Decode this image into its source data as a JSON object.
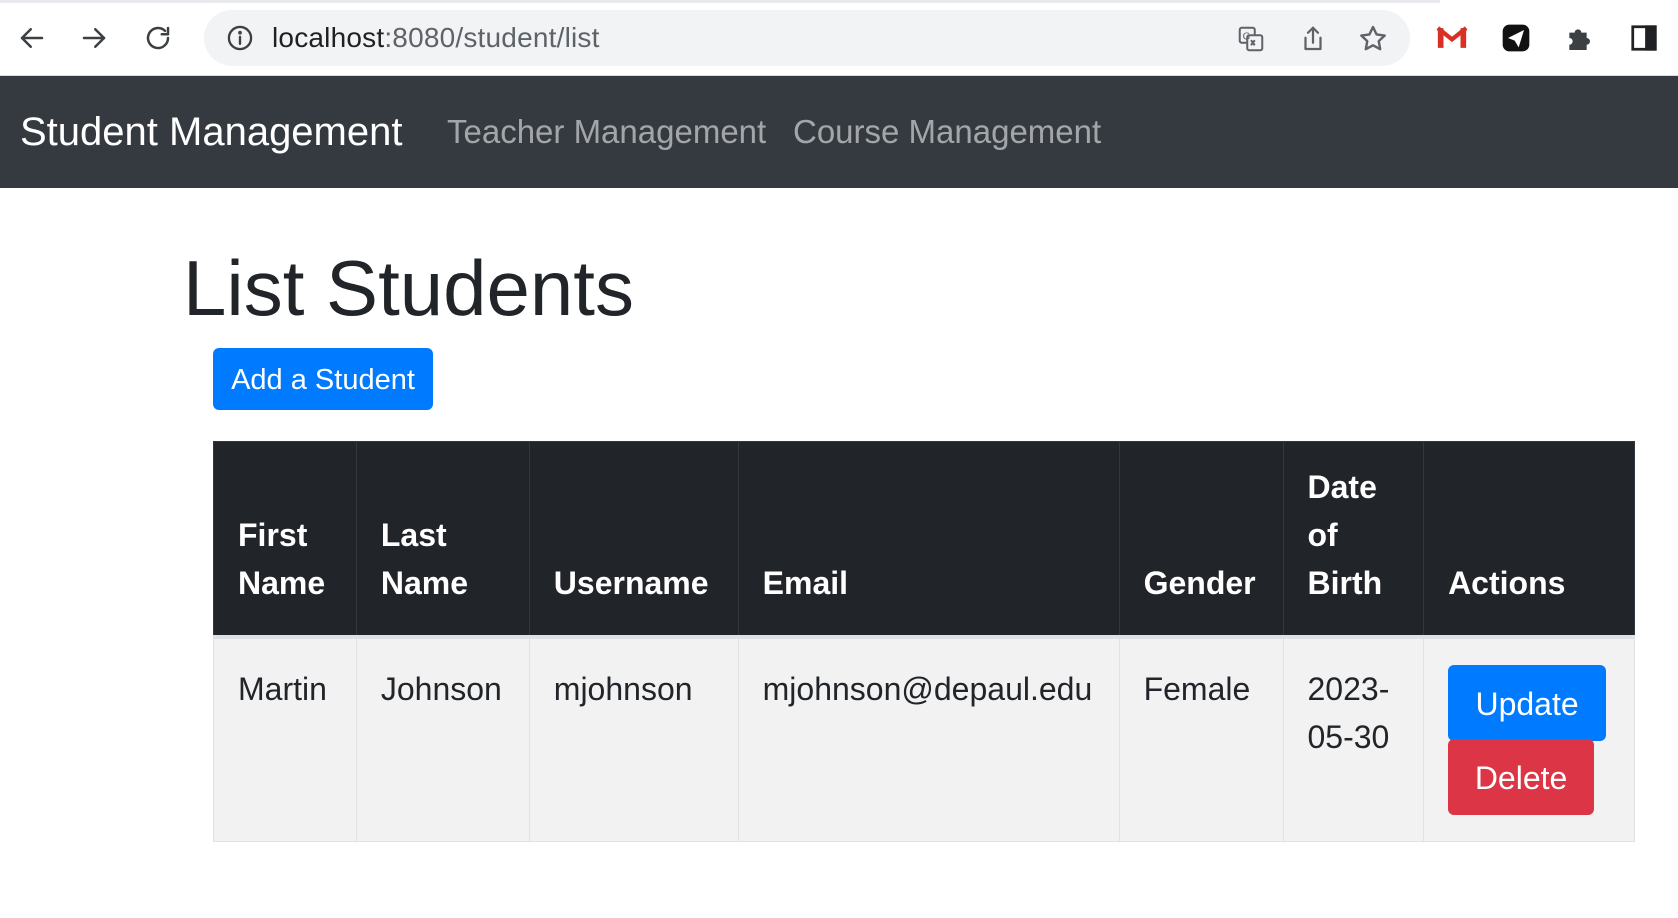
{
  "browser": {
    "url_host": "localhost",
    "url_rest": ":8080/student/list",
    "icons": {
      "back": "back-arrow-icon",
      "forward": "forward-arrow-icon",
      "reload": "reload-icon",
      "info": "info-icon",
      "translate": "translate-icon",
      "share": "share-icon",
      "bookmark": "star-icon",
      "gmail": "gmail-icon",
      "extension_send": "send-extension-icon",
      "extensions": "puzzle-icon",
      "side_panel": "side-panel-icon"
    }
  },
  "navbar": {
    "brand": "Student Management",
    "links": [
      "Teacher Management",
      "Course Management"
    ],
    "background": "#343a40"
  },
  "main": {
    "title": "List Students",
    "add_button_label": "Add a Student",
    "table": {
      "headers": {
        "first_name": "First Name",
        "last_name": "Last Name",
        "username": "Username",
        "email": "Email",
        "gender": "Gender",
        "dob": "Date of Birth",
        "actions": "Actions"
      },
      "rows": [
        {
          "first_name": "Martin",
          "last_name": "Johnson",
          "username": "mjohnson",
          "email": "mjohnson@depaul.edu",
          "gender": "Female",
          "dob": "2023-05-30",
          "update_label": "Update",
          "delete_label": "Delete"
        }
      ]
    }
  },
  "colors": {
    "primary": "#007bff",
    "danger": "#dc3545",
    "table_header": "#212529",
    "row_background": "#f2f2f2"
  }
}
